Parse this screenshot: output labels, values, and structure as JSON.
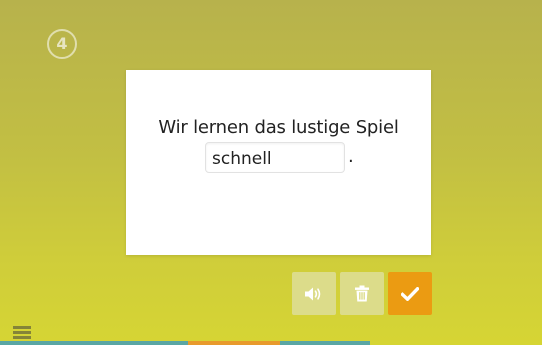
{
  "exercise": {
    "step_number": "4",
    "sentence": "Wir lernen das lustige Spiel",
    "answer_value": "schnell",
    "trailing_punctuation": "."
  },
  "actions": {
    "audio_icon": "volume-up-icon",
    "delete_icon": "trash-icon",
    "check_icon": "check-icon"
  },
  "menu_icon": "hamburger-menu-icon",
  "progress": {
    "segments": [
      {
        "color": "#5aa6a4"
      },
      {
        "color": "#e89a2c"
      },
      {
        "color": "#5aa6a4"
      }
    ]
  },
  "colors": {
    "background_top": "#b7b24c",
    "background_bottom": "#d6d534",
    "secondary_button": "#dcdc8a",
    "primary_button": "#eb9b12"
  }
}
